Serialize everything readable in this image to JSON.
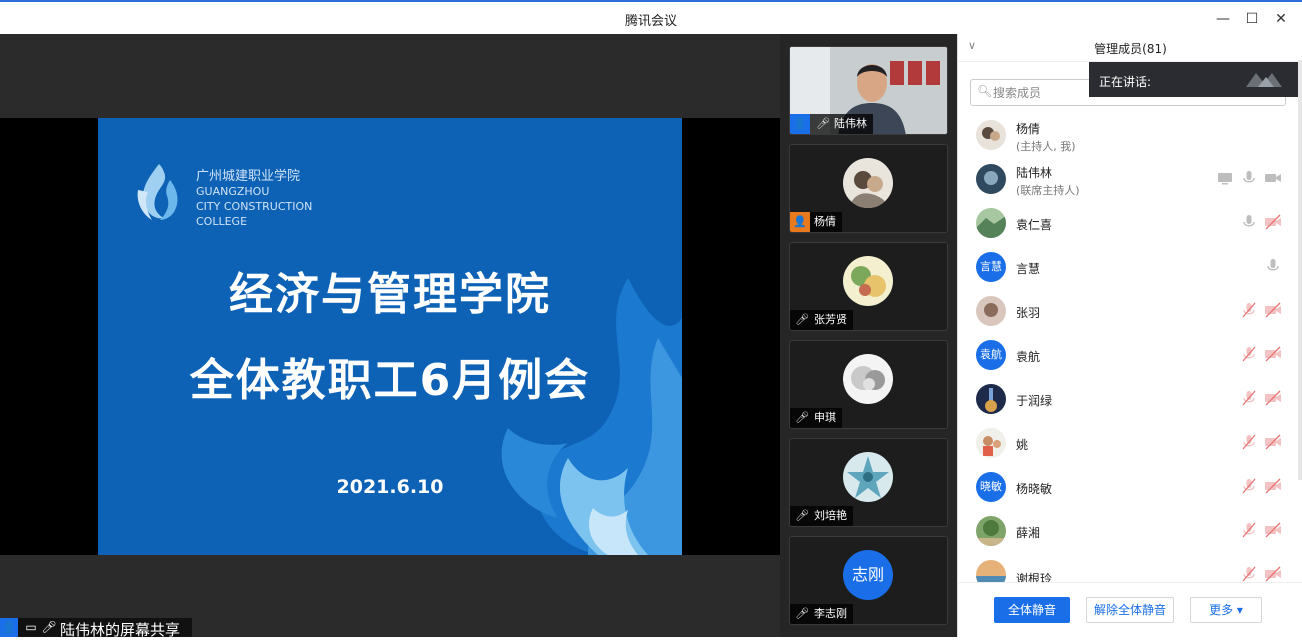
{
  "window": {
    "title": "腾讯会议"
  },
  "slide": {
    "college_cn": "广州城建职业学院",
    "college_en_1": "GUANGZHOU",
    "college_en_2": "CITY CONSTRUCTION",
    "college_en_3": "COLLEGE",
    "heading1": "经济与管理学院",
    "heading2": "全体教职工6月例会",
    "date": "2021.6.10"
  },
  "share_label": "陆伟林的屏幕共享",
  "thumbnails": [
    {
      "name": "陆伟林"
    },
    {
      "name": "杨倩"
    },
    {
      "name": "张芳贤"
    },
    {
      "name": "申琪"
    },
    {
      "name": "刘培艳"
    },
    {
      "name": "李志刚",
      "avatar_text": "志刚"
    }
  ],
  "panel": {
    "title": "管理成员(81)",
    "speaking_label": "正在讲话:",
    "search_placeholder": "搜索成员",
    "members": [
      {
        "name": "杨倩",
        "role": "(主持人, 我)"
      },
      {
        "name": "陆伟林",
        "role": "(联席主持人)"
      },
      {
        "name": "袁仁喜",
        "role": ""
      },
      {
        "name": "言慧",
        "role": "",
        "avatar_text": "言慧"
      },
      {
        "name": "张羽",
        "role": ""
      },
      {
        "name": "袁航",
        "role": "",
        "avatar_text": "袁航"
      },
      {
        "name": "于润绿",
        "role": ""
      },
      {
        "name": "姚",
        "role": ""
      },
      {
        "name": "杨晓敏",
        "role": "",
        "avatar_text": "晓敏"
      },
      {
        "name": "薛湘",
        "role": ""
      },
      {
        "name": "谢根玲",
        "role": ""
      }
    ],
    "buttons": {
      "mute_all": "全体静音",
      "unmute_all": "解除全体静音",
      "more": "更多 ▾"
    }
  },
  "colors": {
    "accent": "#1a6fe8",
    "slide_bg": "#0e62b5",
    "muted_icon": "#e57373"
  }
}
